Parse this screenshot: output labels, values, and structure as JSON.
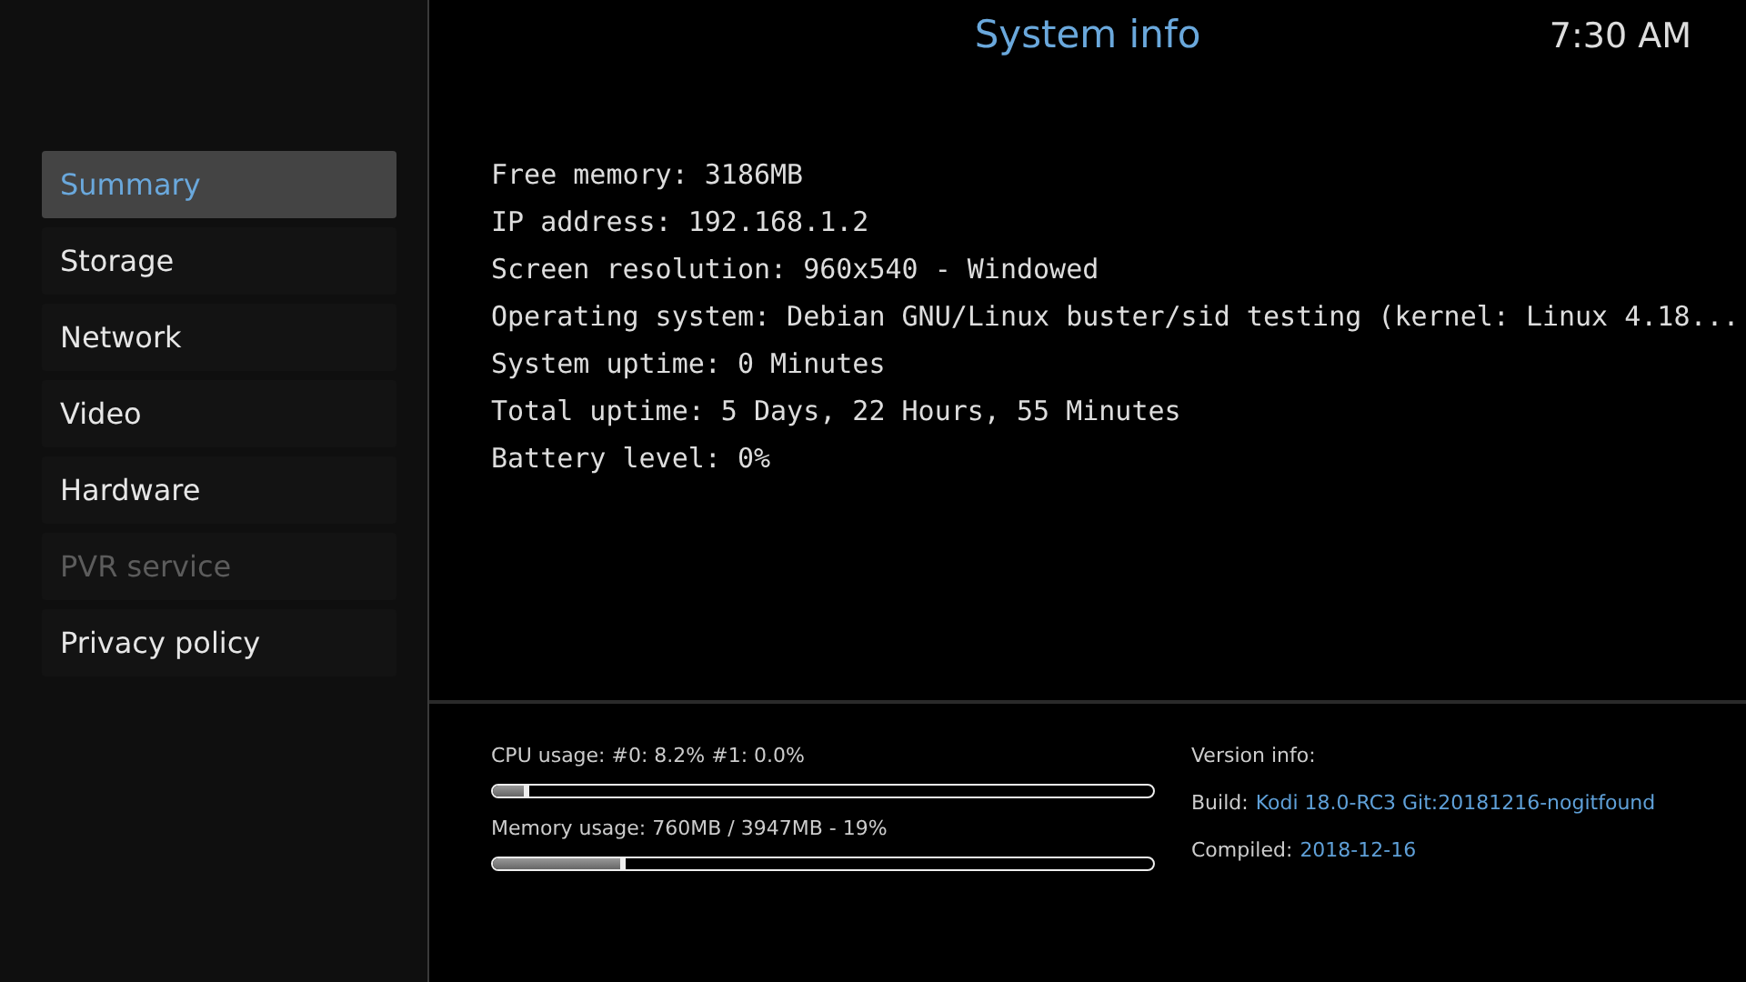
{
  "header": {
    "title": "System info",
    "clock": "7:30 AM"
  },
  "sidebar": {
    "items": [
      {
        "label": "Summary",
        "selected": true,
        "disabled": false
      },
      {
        "label": "Storage",
        "selected": false,
        "disabled": false
      },
      {
        "label": "Network",
        "selected": false,
        "disabled": false
      },
      {
        "label": "Video",
        "selected": false,
        "disabled": false
      },
      {
        "label": "Hardware",
        "selected": false,
        "disabled": false
      },
      {
        "label": "PVR service",
        "selected": false,
        "disabled": true
      },
      {
        "label": "Privacy policy",
        "selected": false,
        "disabled": false
      }
    ]
  },
  "info_lines": [
    "Free memory: 3186MB",
    "IP address: 192.168.1.2",
    "Screen resolution: 960x540 - Windowed",
    "Operating system: Debian GNU/Linux buster/sid testing (kernel: Linux 4.18...",
    "System uptime: 0 Minutes",
    "Total uptime: 5 Days, 22 Hours, 55 Minutes",
    "Battery level: 0%"
  ],
  "usage": [
    {
      "label": "CPU usage: #0: 8.2% #1: 0.0%",
      "level": 0.055
    },
    {
      "label": "Memory usage: 760MB / 3947MB - 19%",
      "level": 0.2
    }
  ],
  "version": {
    "heading": "Version info:",
    "rows": [
      {
        "label": "Build:",
        "value": "Kodi 18.0-RC3 Git:20181216-nogitfound"
      },
      {
        "label": "Compiled:",
        "value": "2018-12-16"
      }
    ]
  }
}
